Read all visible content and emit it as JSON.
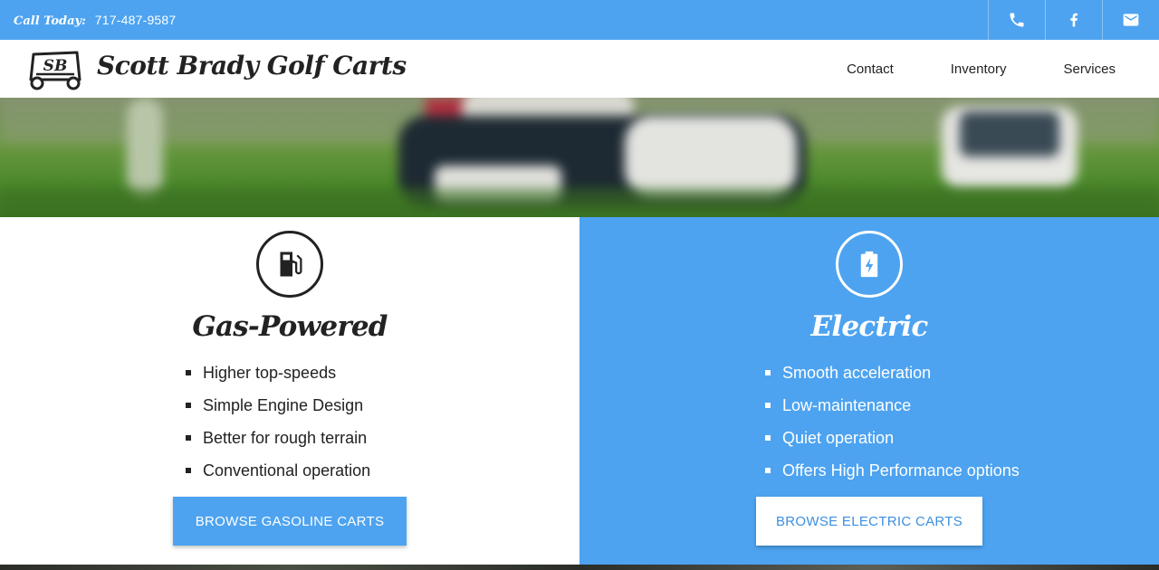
{
  "topbar": {
    "call_label": "Call Today:",
    "phone": "717-487-9587",
    "social": [
      "phone-icon",
      "facebook-icon",
      "email-icon"
    ]
  },
  "header": {
    "logo_text": "SB",
    "brand": "Scott Brady Golf Carts",
    "nav": [
      "Contact",
      "Inventory",
      "Services"
    ]
  },
  "colors": {
    "accent": "#4da3f0",
    "text_dark": "#222222",
    "white": "#ffffff"
  },
  "gas": {
    "icon": "fuel-pump-icon",
    "title": "Gas-Powered",
    "features": [
      "Higher top-speeds",
      "Simple Engine Design",
      "Better for rough terrain",
      "Conventional operation"
    ],
    "button": "BROWSE GASOLINE CARTS"
  },
  "electric": {
    "icon": "battery-charging-icon",
    "title": "Electric",
    "features": [
      "Smooth acceleration",
      "Low-maintenance",
      "Quiet operation",
      "Offers High Performance options"
    ],
    "button": "BROWSE ELECTRIC CARTS"
  }
}
